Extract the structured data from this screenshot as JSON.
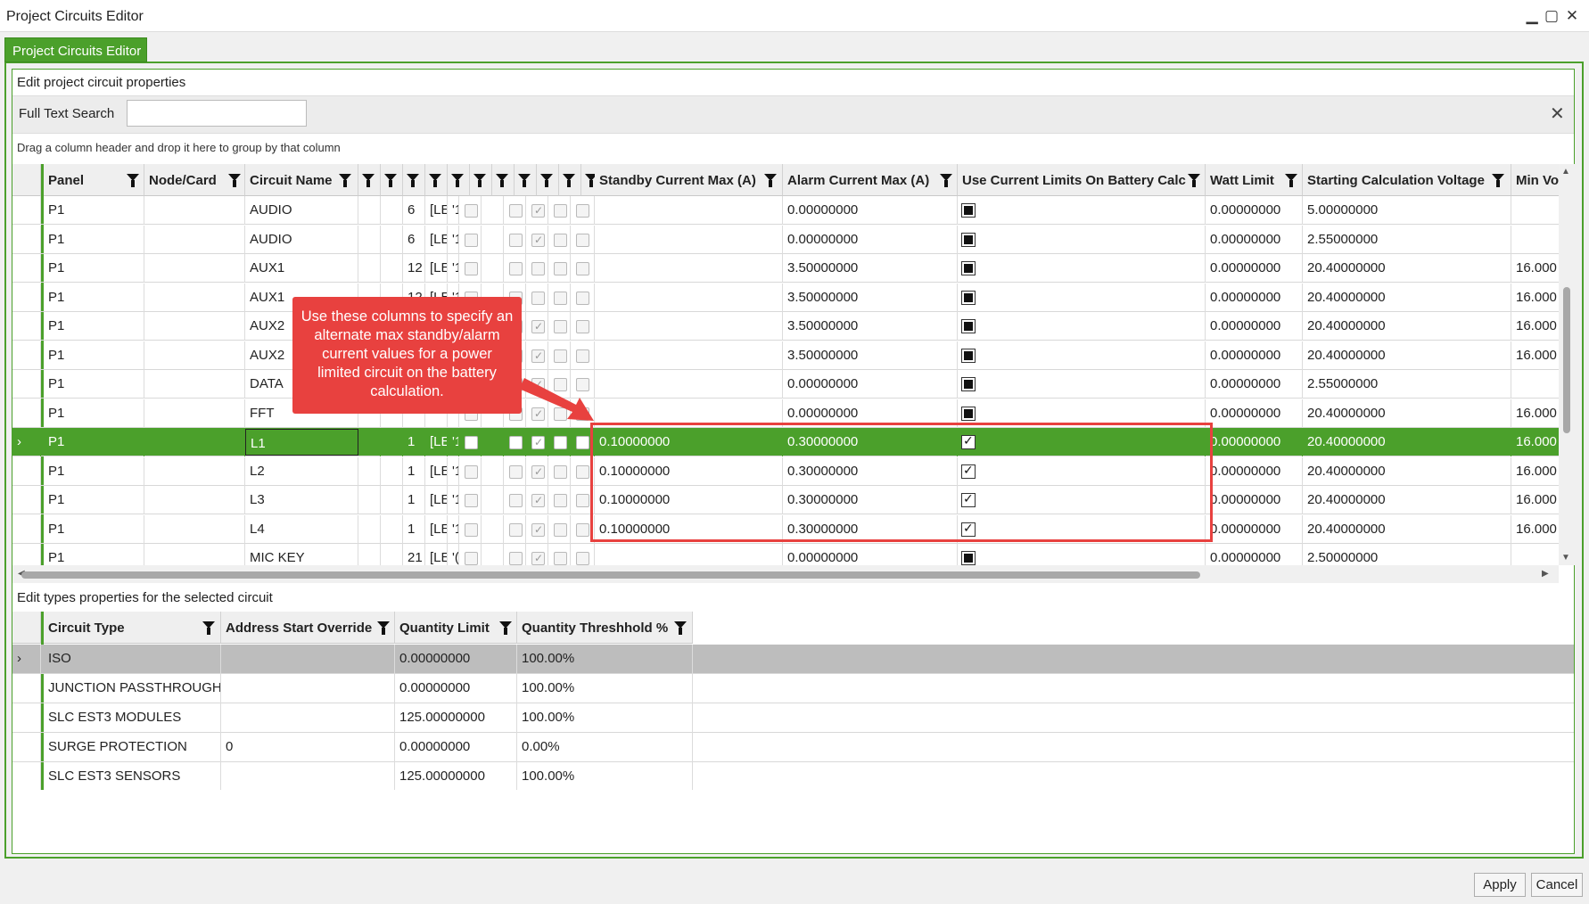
{
  "window": {
    "title": "Project Circuits Editor",
    "controls": [
      "▁",
      "▢",
      "✕"
    ]
  },
  "tab": {
    "label": "Project Circuits Editor"
  },
  "section1": {
    "label": "Edit project circuit properties"
  },
  "search": {
    "label": "Full Text Search",
    "value": "",
    "clear": "✕"
  },
  "group_hint": "Drag a column header and drop it here to group by that column",
  "circuits": {
    "headers": {
      "panel": "Panel",
      "node": "Node/Card",
      "circuit": "Circuit Name",
      "standby": "Standby Current Max (A)",
      "alarm": "Alarm Current Max (A)",
      "use_limits": "Use Current Limits On Battery Calc",
      "watt": "Watt Limit",
      "start_v": "Starting Calculation Voltage",
      "min_v": "Min Vo"
    },
    "rows": [
      {
        "panel": "P1",
        "circuit": "AUDIO",
        "n": "6",
        "c1": "[LE",
        "c2": "'1",
        "standby": "",
        "alarm": "0.00000000",
        "use": "fill",
        "watt": "0.00000000",
        "start": "5.00000000",
        "min": ""
      },
      {
        "panel": "P1",
        "circuit": "AUDIO",
        "n": "6",
        "c1": "[LE",
        "c2": "'1",
        "standby": "",
        "alarm": "0.00000000",
        "use": "fill",
        "watt": "0.00000000",
        "start": "2.55000000",
        "min": ""
      },
      {
        "panel": "P1",
        "circuit": "AUX1",
        "n": "12",
        "c1": "[LE",
        "c2": "'1",
        "standby": "",
        "alarm": "3.50000000",
        "use": "fill",
        "watt": "0.00000000",
        "start": "20.40000000",
        "min": "16.000"
      },
      {
        "panel": "P1",
        "circuit": "AUX1",
        "n": "12",
        "c1": "[LE",
        "c2": "'1",
        "standby": "",
        "alarm": "3.50000000",
        "use": "fill",
        "watt": "0.00000000",
        "start": "20.40000000",
        "min": "16.000"
      },
      {
        "panel": "P1",
        "circuit": "AUX2",
        "n": "",
        "c1": "",
        "c2": "",
        "standby": "",
        "alarm": "3.50000000",
        "use": "fill",
        "watt": "0.00000000",
        "start": "20.40000000",
        "min": "16.000"
      },
      {
        "panel": "P1",
        "circuit": "AUX2",
        "n": "",
        "c1": "",
        "c2": "",
        "standby": "",
        "alarm": "3.50000000",
        "use": "fill",
        "watt": "0.00000000",
        "start": "20.40000000",
        "min": "16.000"
      },
      {
        "panel": "P1",
        "circuit": "DATA",
        "n": "",
        "c1": "",
        "c2": "",
        "standby": "",
        "alarm": "0.00000000",
        "use": "fill",
        "watt": "0.00000000",
        "start": "2.55000000",
        "min": ""
      },
      {
        "panel": "P1",
        "circuit": "FFT",
        "n": "",
        "c1": "",
        "c2": "",
        "standby": "",
        "alarm": "0.00000000",
        "use": "fill",
        "watt": "0.00000000",
        "start": "20.40000000",
        "min": "16.000"
      },
      {
        "panel": "P1",
        "circuit": "L1",
        "n": "1",
        "c1": "[LE",
        "c2": "'1",
        "standby": "0.10000000",
        "alarm": "0.30000000",
        "use": "tick",
        "watt": "0.00000000",
        "start": "20.40000000",
        "min": "16.000",
        "selected": true
      },
      {
        "panel": "P1",
        "circuit": "L2",
        "n": "1",
        "c1": "[LE",
        "c2": "'1",
        "standby": "0.10000000",
        "alarm": "0.30000000",
        "use": "tick",
        "watt": "0.00000000",
        "start": "20.40000000",
        "min": "16.000"
      },
      {
        "panel": "P1",
        "circuit": "L3",
        "n": "1",
        "c1": "[LE",
        "c2": "'1",
        "standby": "0.10000000",
        "alarm": "0.30000000",
        "use": "tick",
        "watt": "0.00000000",
        "start": "20.40000000",
        "min": "16.000"
      },
      {
        "panel": "P1",
        "circuit": "L4",
        "n": "1",
        "c1": "[LE",
        "c2": "'1",
        "standby": "0.10000000",
        "alarm": "0.30000000",
        "use": "tick",
        "watt": "0.00000000",
        "start": "20.40000000",
        "min": "16.000"
      },
      {
        "panel": "P1",
        "circuit": "MIC KEY",
        "n": "21",
        "c1": "[LE",
        "c2": "'(",
        "standby": "",
        "alarm": "0.00000000",
        "use": "fill",
        "watt": "0.00000000",
        "start": "2.50000000",
        "min": ""
      }
    ]
  },
  "annotation": {
    "text": "Use these columns to specify an alternate max standby/alarm current values for a power limited circuit on the battery calculation.",
    "color": "#e8413f"
  },
  "section2": {
    "label": "Edit types properties for the selected circuit"
  },
  "types": {
    "headers": {
      "type": "Circuit Type",
      "addr": "Address Start Override",
      "qty": "Quantity Limit",
      "thr": "Quantity Threshhold %"
    },
    "rows": [
      {
        "type": "ISO",
        "addr": "",
        "qty": "0.00000000",
        "thr": "100.00%",
        "selected": true
      },
      {
        "type": "JUNCTION PASSTHROUGH",
        "addr": "",
        "qty": "0.00000000",
        "thr": "100.00%"
      },
      {
        "type": "SLC EST3 MODULES",
        "addr": "",
        "qty": "125.00000000",
        "thr": "100.00%"
      },
      {
        "type": "SURGE PROTECTION",
        "addr": "0",
        "qty": "0.00000000",
        "thr": "0.00%"
      },
      {
        "type": "SLC EST3 SENSORS",
        "addr": "",
        "qty": "125.00000000",
        "thr": "100.00%"
      }
    ]
  },
  "buttons": {
    "apply": "Apply",
    "cancel": "Cancel"
  },
  "colors": {
    "accent": "#4ba02b",
    "annotation": "#e8413f",
    "selected_row_alt": "#bdbdbd"
  }
}
